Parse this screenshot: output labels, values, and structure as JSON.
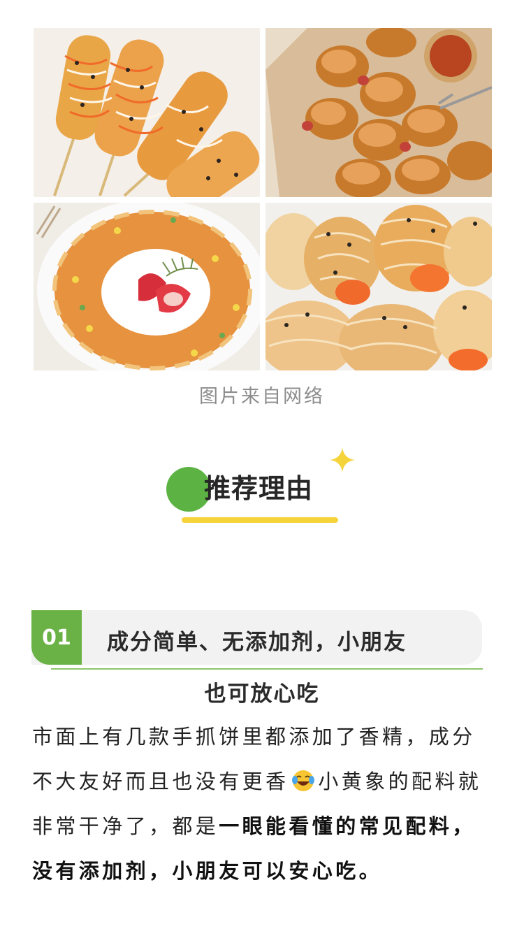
{
  "caption": "图片来自网络",
  "section": {
    "title": "推荐理由"
  },
  "item1": {
    "number": "01",
    "title_line1": "成分简单、无添加剂，小朋友",
    "title_line2": "也可放心吃"
  },
  "body": {
    "part1": "市面上有几款手抓饼里都添加了香精，成分不大友好而且也没有更香",
    "emoji": "laughing-tears-emoji",
    "part2": "小黄象的配料就非常干净了，都是",
    "bold": "一眼能看懂的常见配料，没有添加剂，小朋友可以安心吃。"
  },
  "colors": {
    "accent_green": "#5cb343",
    "accent_yellow": "#f5d33b",
    "caption_gray": "#8c8c8c"
  }
}
